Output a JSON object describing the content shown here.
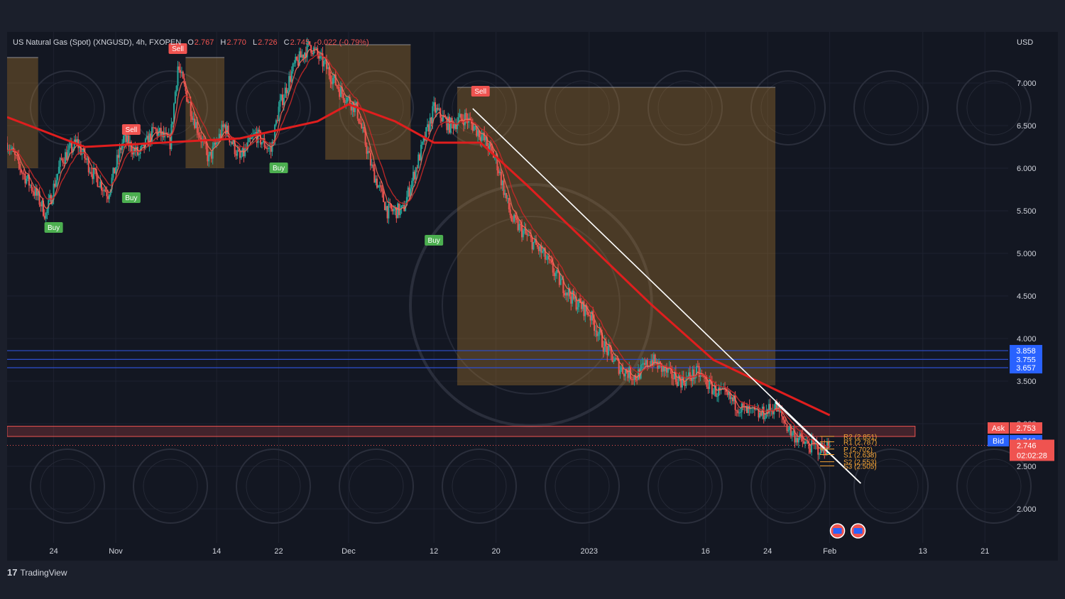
{
  "header": {
    "symbol": "US Natural Gas (Spot) (XNGUSD), 4h, FXOPEN",
    "open_label": "O",
    "open": "2.767",
    "high_label": "H",
    "high": "2.770",
    "low_label": "L",
    "low": "2.726",
    "close_label": "C",
    "close": "2.745",
    "change": "-0.022 (-0.79%)"
  },
  "currency": "USD",
  "brand": "TradingView",
  "colors": {
    "background": "#131722",
    "frame": "#1b1f2b",
    "grid": "#1e2230",
    "text": "#d1d4dc",
    "up": "#26a69a",
    "down": "#ef5350",
    "ema": "#e01e1e",
    "support_line": "#2e4fd0",
    "zone": "#c1862f"
  },
  "chart_data": {
    "type": "candlestick",
    "y_scale": {
      "min": 1.6,
      "max": 7.6
    },
    "y_ticks": [
      2.0,
      2.5,
      3.0,
      3.5,
      4.0,
      4.5,
      5.0,
      5.5,
      6.0,
      6.5,
      7.0
    ],
    "y_tick_labels": [
      "2.000",
      "2.500",
      "3.000",
      "3.500",
      "4.000",
      "4.500",
      "5.000",
      "5.500",
      "6.000",
      "6.500",
      "7.000"
    ],
    "x_range": [
      "2022-10-18",
      "2023-02-24"
    ],
    "x_ticks": [
      {
        "date": "2022-10-24",
        "label": "24"
      },
      {
        "date": "2022-11-01",
        "label": "Nov"
      },
      {
        "date": "2022-11-14",
        "label": "14"
      },
      {
        "date": "2022-11-22",
        "label": "22"
      },
      {
        "date": "2022-12-01",
        "label": "Dec"
      },
      {
        "date": "2022-12-12",
        "label": "12"
      },
      {
        "date": "2022-12-20",
        "label": "20"
      },
      {
        "date": "2023-01-01",
        "label": "2023"
      },
      {
        "date": "2023-01-16",
        "label": "16"
      },
      {
        "date": "2023-01-24",
        "label": "24"
      },
      {
        "date": "2023-02-01",
        "label": "Feb"
      },
      {
        "date": "2023-02-13",
        "label": "13"
      },
      {
        "date": "2023-02-21",
        "label": "21"
      }
    ],
    "price_path": [
      {
        "t": "2022-10-18",
        "p": 6.3
      },
      {
        "t": "2022-10-20",
        "p": 5.95
      },
      {
        "t": "2022-10-22",
        "p": 5.65
      },
      {
        "t": "2022-10-23",
        "p": 5.45
      },
      {
        "t": "2022-10-25",
        "p": 6.1
      },
      {
        "t": "2022-10-27",
        "p": 6.3
      },
      {
        "t": "2022-10-29",
        "p": 5.95
      },
      {
        "t": "2022-10-31",
        "p": 5.7
      },
      {
        "t": "2022-11-02",
        "p": 6.35
      },
      {
        "t": "2022-11-04",
        "p": 6.15
      },
      {
        "t": "2022-11-06",
        "p": 6.45
      },
      {
        "t": "2022-11-08",
        "p": 6.3
      },
      {
        "t": "2022-11-09",
        "p": 7.2
      },
      {
        "t": "2022-11-11",
        "p": 6.6
      },
      {
        "t": "2022-11-13",
        "p": 6.1
      },
      {
        "t": "2022-11-15",
        "p": 6.5
      },
      {
        "t": "2022-11-17",
        "p": 6.1
      },
      {
        "t": "2022-11-19",
        "p": 6.4
      },
      {
        "t": "2022-11-21",
        "p": 6.2
      },
      {
        "t": "2022-11-22",
        "p": 6.7
      },
      {
        "t": "2022-11-24",
        "p": 7.2
      },
      {
        "t": "2022-11-26",
        "p": 7.45
      },
      {
        "t": "2022-11-28",
        "p": 7.2
      },
      {
        "t": "2022-11-30",
        "p": 6.9
      },
      {
        "t": "2022-12-02",
        "p": 6.7
      },
      {
        "t": "2022-12-04",
        "p": 6.0
      },
      {
        "t": "2022-12-06",
        "p": 5.5
      },
      {
        "t": "2022-12-08",
        "p": 5.5
      },
      {
        "t": "2022-12-10",
        "p": 6.1
      },
      {
        "t": "2022-12-12",
        "p": 6.7
      },
      {
        "t": "2022-12-14",
        "p": 6.5
      },
      {
        "t": "2022-12-16",
        "p": 6.6
      },
      {
        "t": "2022-12-18",
        "p": 6.4
      },
      {
        "t": "2022-12-20",
        "p": 6.1
      },
      {
        "t": "2022-12-22",
        "p": 5.4
      },
      {
        "t": "2022-12-24",
        "p": 5.2
      },
      {
        "t": "2022-12-26",
        "p": 5.0
      },
      {
        "t": "2022-12-28",
        "p": 4.7
      },
      {
        "t": "2022-12-30",
        "p": 4.45
      },
      {
        "t": "2023-01-01",
        "p": 4.3
      },
      {
        "t": "2023-01-03",
        "p": 3.9
      },
      {
        "t": "2023-01-05",
        "p": 3.65
      },
      {
        "t": "2023-01-07",
        "p": 3.55
      },
      {
        "t": "2023-01-09",
        "p": 3.75
      },
      {
        "t": "2023-01-11",
        "p": 3.6
      },
      {
        "t": "2023-01-13",
        "p": 3.5
      },
      {
        "t": "2023-01-15",
        "p": 3.6
      },
      {
        "t": "2023-01-17",
        "p": 3.4
      },
      {
        "t": "2023-01-19",
        "p": 3.3
      },
      {
        "t": "2023-01-21",
        "p": 3.15
      },
      {
        "t": "2023-01-23",
        "p": 3.1
      },
      {
        "t": "2023-01-25",
        "p": 3.2
      },
      {
        "t": "2023-01-27",
        "p": 2.9
      },
      {
        "t": "2023-01-29",
        "p": 2.75
      },
      {
        "t": "2023-01-31",
        "p": 2.7
      },
      {
        "t": "2023-02-01",
        "p": 2.746
      }
    ],
    "ema_path": [
      {
        "t": "2022-10-18",
        "p": 6.6
      },
      {
        "t": "2022-10-28",
        "p": 6.25
      },
      {
        "t": "2022-11-07",
        "p": 6.3
      },
      {
        "t": "2022-11-17",
        "p": 6.35
      },
      {
        "t": "2022-11-27",
        "p": 6.55
      },
      {
        "t": "2022-12-01",
        "p": 6.75
      },
      {
        "t": "2022-12-07",
        "p": 6.55
      },
      {
        "t": "2022-12-12",
        "p": 6.3
      },
      {
        "t": "2022-12-18",
        "p": 6.3
      },
      {
        "t": "2022-12-24",
        "p": 5.8
      },
      {
        "t": "2023-01-01",
        "p": 5.1
      },
      {
        "t": "2023-01-09",
        "p": 4.4
      },
      {
        "t": "2023-01-17",
        "p": 3.75
      },
      {
        "t": "2023-01-25",
        "p": 3.4
      },
      {
        "t": "2023-02-01",
        "p": 3.1
      }
    ],
    "trendlines": [
      {
        "from": {
          "t": "2022-12-17",
          "p": 6.7
        },
        "to": {
          "t": "2023-02-05",
          "p": 2.3
        }
      },
      {
        "from": {
          "t": "2023-01-25",
          "p": 3.25
        },
        "to": {
          "t": "2023-02-05",
          "p": 2.3
        }
      }
    ],
    "horizontal_levels": [
      3.858,
      3.755,
      3.657
    ],
    "resistance_zone": {
      "from": 2.85,
      "to": 2.97,
      "t_start": "2022-10-18",
      "t_end": "2023-02-12"
    },
    "supply_zones": [
      {
        "t_start": "2022-12-15",
        "t_end": "2023-01-25",
        "top": 6.95,
        "bottom": 3.45
      },
      {
        "t_start": "2022-11-28",
        "t_end": "2022-12-09",
        "top": 7.45,
        "bottom": 6.1
      },
      {
        "t_start": "2022-10-18",
        "t_end": "2022-10-22",
        "top": 7.3,
        "bottom": 6.0
      },
      {
        "t_start": "2022-11-10",
        "t_end": "2022-11-15",
        "top": 7.3,
        "bottom": 6.0
      }
    ],
    "signals": [
      {
        "type": "Sell",
        "t": "2022-11-03",
        "p": 6.45
      },
      {
        "type": "Sell",
        "t": "2022-11-09",
        "p": 7.4
      },
      {
        "type": "Sell",
        "t": "2022-12-18",
        "p": 6.9
      },
      {
        "type": "Buy",
        "t": "2022-10-24",
        "p": 5.3
      },
      {
        "type": "Buy",
        "t": "2022-11-03",
        "p": 5.65
      },
      {
        "type": "Buy",
        "t": "2022-11-22",
        "p": 6.0
      },
      {
        "type": "Buy",
        "t": "2022-12-12",
        "p": 5.15
      }
    ],
    "pivots": [
      {
        "label": "R2 (2.851)",
        "p": 2.851
      },
      {
        "label": "R1 (2.787)",
        "p": 2.787
      },
      {
        "label": "P (2.702)",
        "p": 2.702
      },
      {
        "label": "S1 (2.638)",
        "p": 2.638
      },
      {
        "label": "S2 (2.553)",
        "p": 2.553
      },
      {
        "label": "S3 (2.505)",
        "p": 2.505
      }
    ],
    "badges": [
      {
        "label": "",
        "value": "3.858",
        "p": 3.858,
        "color": "#2962ff"
      },
      {
        "label": "",
        "value": "3.755",
        "p": 3.755,
        "color": "#2962ff"
      },
      {
        "label": "",
        "value": "3.657",
        "p": 3.657,
        "color": "#2962ff"
      },
      {
        "label": "Ask",
        "value": "2.753",
        "p": 2.95,
        "color": "#ef5350"
      },
      {
        "label": "Bid",
        "value": "2.746",
        "p": 2.8,
        "color": "#2962ff"
      }
    ],
    "last_price": {
      "value": "2.746",
      "countdown": "02:02:28",
      "p": 2.746
    },
    "events_at": "2023-02-02"
  }
}
